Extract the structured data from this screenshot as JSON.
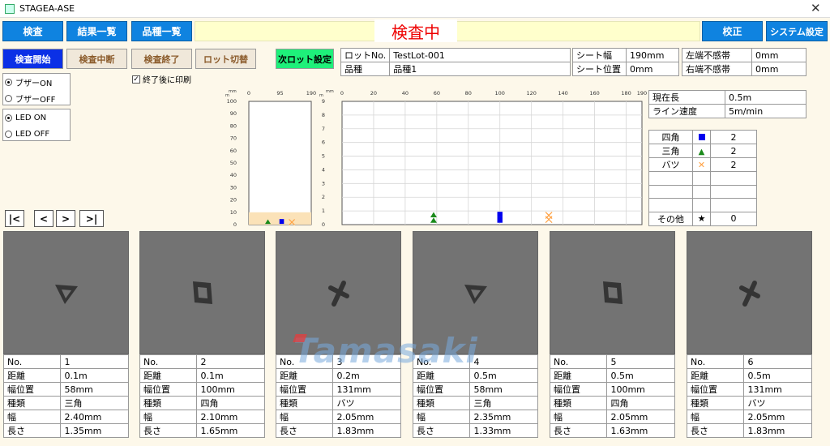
{
  "window": {
    "title": "STAGEA-ASE",
    "close_icon": "close-icon"
  },
  "nav": {
    "inspect": "検査",
    "results": "結果一覧",
    "products": "品種一覧",
    "calibrate": "校正",
    "system": "システム設定"
  },
  "status": {
    "text": "検査中",
    "color": "#ee0000"
  },
  "controls": {
    "start": "検査開始",
    "stop": "検査中断",
    "end": "検査終了",
    "lot_switch": "ロット切替",
    "next_lot": "次ロット設定",
    "print_after": "終了後に印刷",
    "print_after_checked": true
  },
  "buzzer": {
    "on": "ブザーON",
    "off": "ブザーOFF",
    "selected": "on"
  },
  "led": {
    "on": "LED ON",
    "off": "LED OFF",
    "selected": "on"
  },
  "pager": {
    "first": "|<",
    "prev": "<",
    "next": ">",
    "last": ">|"
  },
  "info": {
    "lot_label": "ロットNo.",
    "lot_value": "TestLot-001",
    "product_label": "品種",
    "product_value": "品種1",
    "sheet_width_label": "シート幅",
    "sheet_width_value": "190mm",
    "sheet_pos_label": "シート位置",
    "sheet_pos_value": "0mm",
    "left_dead_label": "左端不感帯",
    "left_dead_value": "0mm",
    "right_dead_label": "右端不感帯",
    "right_dead_value": "0mm"
  },
  "current": {
    "length_label": "現在長",
    "length_value": "0.5m",
    "speed_label": "ライン速度",
    "speed_value": "5m/min"
  },
  "legend": {
    "rows": [
      {
        "name": "四角",
        "icon": "blue-square-icon",
        "count": "2"
      },
      {
        "name": "三角",
        "icon": "green-triangle-icon",
        "count": "2"
      },
      {
        "name": "バツ",
        "icon": "orange-cross-icon",
        "count": "2"
      },
      {
        "name": "",
        "icon": "",
        "count": ""
      },
      {
        "name": "",
        "icon": "",
        "count": ""
      },
      {
        "name": "",
        "icon": "",
        "count": ""
      },
      {
        "name": "その他",
        "icon": "star-icon",
        "count": "0"
      }
    ]
  },
  "chart_data": [
    {
      "type": "scatter",
      "title": "",
      "xlabel": "mm",
      "ylabel": "m",
      "xlim": [
        0,
        190
      ],
      "ylim": [
        0,
        100
      ],
      "x_ticks": [
        "0",
        "95",
        "190"
      ],
      "y_ticks": [
        "100",
        "90",
        "80",
        "70",
        "60",
        "50",
        "40",
        "30",
        "20",
        "10",
        "0"
      ],
      "band": {
        "y0": 0,
        "y1": 10,
        "color": "#fbe2b8"
      },
      "series": [
        {
          "name": "三角",
          "marker": "triangle",
          "color": "#1a8a1a",
          "x": [
            58
          ],
          "y": [
            0
          ]
        },
        {
          "name": "四角",
          "marker": "square",
          "color": "#0000ee",
          "x": [
            100
          ],
          "y": [
            0
          ]
        },
        {
          "name": "バツ",
          "marker": "cross",
          "color": "#ffa040",
          "x": [
            131
          ],
          "y": [
            0
          ]
        }
      ]
    },
    {
      "type": "scatter",
      "title": "",
      "xlabel": "mm",
      "ylabel": "m",
      "xlim": [
        0,
        190
      ],
      "ylim": [
        0,
        9
      ],
      "x_ticks": [
        "0",
        "20",
        "40",
        "60",
        "80",
        "100",
        "120",
        "140",
        "160",
        "180",
        "190"
      ],
      "y_ticks": [
        "9",
        "8",
        "7",
        "6",
        "5",
        "4",
        "3",
        "2",
        "1",
        "0"
      ],
      "series": [
        {
          "name": "三角",
          "marker": "triangle",
          "color": "#1a8a1a",
          "x": [
            58,
            58
          ],
          "y": [
            0.1,
            0.5
          ]
        },
        {
          "name": "四角",
          "marker": "square",
          "color": "#0000ee",
          "x": [
            100,
            100
          ],
          "y": [
            0.1,
            0.5
          ]
        },
        {
          "name": "バツ",
          "marker": "cross",
          "color": "#ffa040",
          "x": [
            131,
            131
          ],
          "y": [
            0.2,
            0.5
          ]
        }
      ]
    }
  ],
  "defects": [
    {
      "glyph": "triangle",
      "no": "1",
      "dist": "0.1m",
      "pos": "58mm",
      "kind": "三角",
      "width": "2.40mm",
      "length": "1.35mm"
    },
    {
      "glyph": "square",
      "no": "2",
      "dist": "0.1m",
      "pos": "100mm",
      "kind": "四角",
      "width": "2.10mm",
      "length": "1.65mm"
    },
    {
      "glyph": "cross",
      "no": "3",
      "dist": "0.2m",
      "pos": "131mm",
      "kind": "バツ",
      "width": "2.05mm",
      "length": "1.83mm"
    },
    {
      "glyph": "triangle",
      "no": "4",
      "dist": "0.5m",
      "pos": "58mm",
      "kind": "三角",
      "width": "2.35mm",
      "length": "1.33mm"
    },
    {
      "glyph": "square",
      "no": "5",
      "dist": "0.5m",
      "pos": "100mm",
      "kind": "四角",
      "width": "2.05mm",
      "length": "1.63mm"
    },
    {
      "glyph": "cross",
      "no": "6",
      "dist": "0.5m",
      "pos": "131mm",
      "kind": "バツ",
      "width": "2.05mm",
      "length": "1.83mm"
    }
  ],
  "defect_labels": {
    "no": "No.",
    "dist": "距離",
    "pos": "幅位置",
    "kind": "種類",
    "width": "幅",
    "length": "長さ"
  },
  "watermark": "Tamasaki"
}
